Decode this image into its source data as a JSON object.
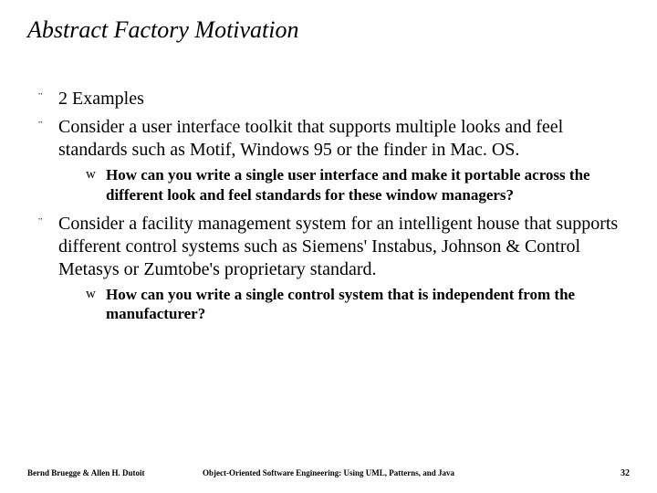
{
  "title": "Abstract Factory Motivation",
  "bullets": {
    "b0": "2 Examples",
    "b1": "Consider a user interface toolkit that supports multiple looks and feel standards such as Motif, Windows 95 or the finder in Mac. OS.",
    "s1": "How can you write a single user interface and make it portable across the different look and feel standards for these window managers?",
    "b2": "Consider a facility management system for an intelligent house that supports different control systems such as Siemens' Instabus, Johnson & Control Metasys or Zumtobe's proprietary standard.",
    "s2": "How can you write a single control system that is independent from the manufacturer?"
  },
  "footer": {
    "left": "Bernd Bruegge & Allen H. Dutoit",
    "center": "Object-Oriented Software Engineering: Using UML, Patterns, and Java",
    "right": "32"
  }
}
